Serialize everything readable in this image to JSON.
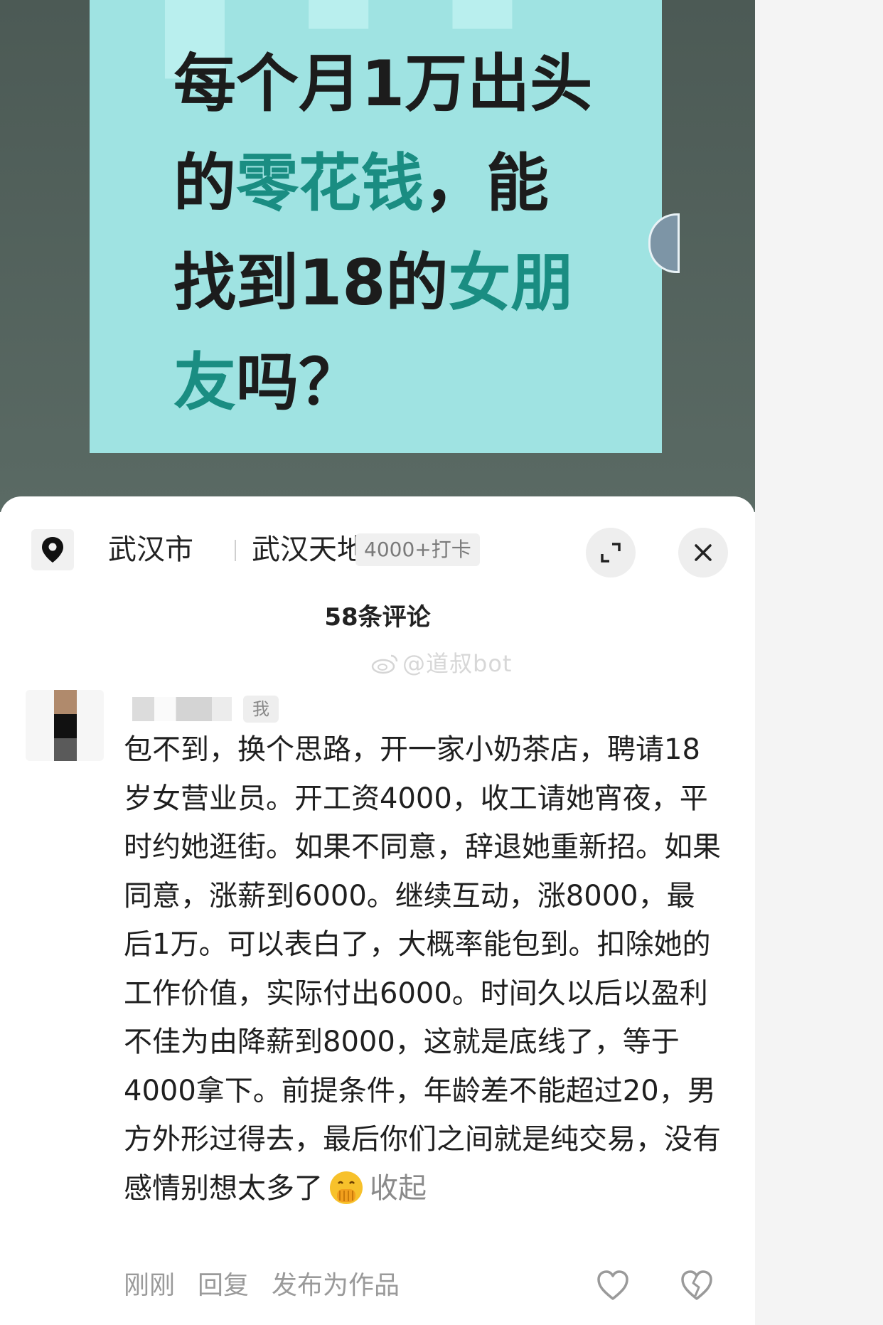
{
  "poster": {
    "line1": "每个月1万出头",
    "line2_a": "的",
    "line2_hl": "零花钱",
    "line2_b": "，能",
    "line3_a": "找到18的",
    "line3_hl": "女朋",
    "line4_hl": "友",
    "line4_b": "吗？"
  },
  "location": {
    "city": "武汉市",
    "place": "武汉天地",
    "badge": "4000+打卡"
  },
  "comments": {
    "count_label": "58条评论",
    "watermark": "@道叔bot"
  },
  "comment": {
    "me_badge": "我",
    "text": "包不到，换个思路，开一家小奶茶店，聘请18岁女营业员。开工资4000，收工请她宵夜，平时约她逛街。如果不同意，辞退她重新招。如果同意，涨薪到6000。继续互动，涨8000，最后1万。可以表白了，大概率能包到。扣除她的工作价值，实际付出6000。时间久以后以盈利不佳为由降薪到8000，这就是底线了，等于4000拿下。前提条件，年龄差不能超过20，男方外形过得去，最后你们之间就是纯交易，没有感情别想太多了",
    "collapse_label": "收起",
    "time": "刚刚",
    "reply_label": "回复",
    "publish_label": "发布为作品"
  },
  "icons": {
    "location": "location-pin-icon",
    "expand": "expand-icon",
    "close": "close-icon",
    "emoji": "face-with-hand-over-mouth-emoji",
    "like": "heart-icon",
    "dislike": "broken-heart-icon"
  },
  "colors": {
    "poster_bg": "#9fe3e2",
    "highlight_text": "#1a8d82",
    "highlight_underline": "#f2e76a"
  }
}
